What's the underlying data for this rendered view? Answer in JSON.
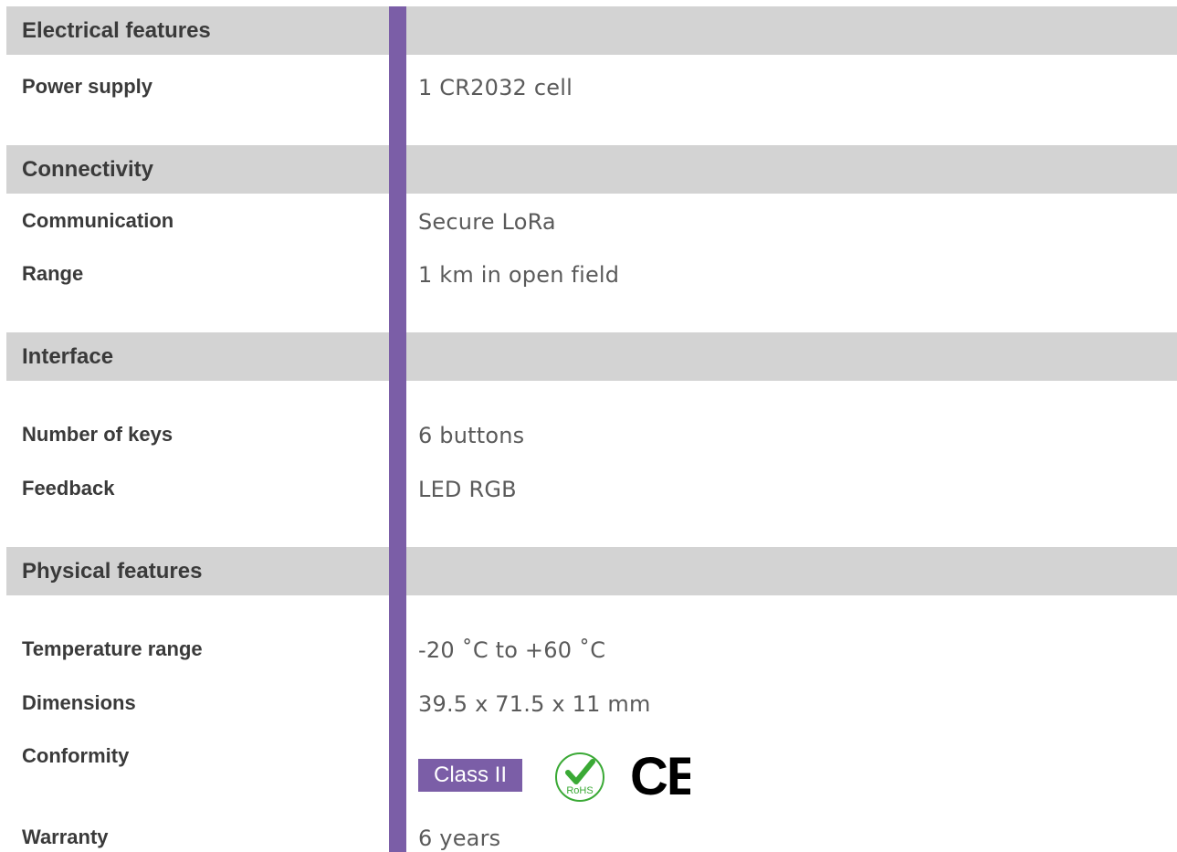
{
  "sections": [
    {
      "title": "Electrical features"
    },
    {
      "title": "Connectivity"
    },
    {
      "title": "Interface"
    },
    {
      "title": "Physical features"
    }
  ],
  "rows": [
    {
      "label": "Power supply",
      "value": "1 CR2032 cell"
    },
    {
      "label": "Communication",
      "value": "Secure LoRa"
    },
    {
      "label": "Range",
      "value": "1 km in open field"
    },
    {
      "label": "Number of keys",
      "value": "6 buttons"
    },
    {
      "label": "Feedback",
      "value": "LED RGB"
    },
    {
      "label": "Temperature range",
      "value": "-20 ˚C to +60 ˚C"
    },
    {
      "label": "Dimensions",
      "value": "39.5 x 71.5 x 11 mm"
    },
    {
      "label": "Conformity",
      "value": ""
    },
    {
      "label": "Warranty",
      "value": "6 years"
    }
  ],
  "conformity": {
    "badge_text": "Class II",
    "rohs_text": "RoHS",
    "ce_text": "CE",
    "icons": [
      "class-ii-badge",
      "rohs-icon",
      "ce-mark-icon"
    ]
  },
  "colors": {
    "accent": "#7b5ea7",
    "band": "#d3d3d3",
    "rohs_green": "#3aa935"
  }
}
